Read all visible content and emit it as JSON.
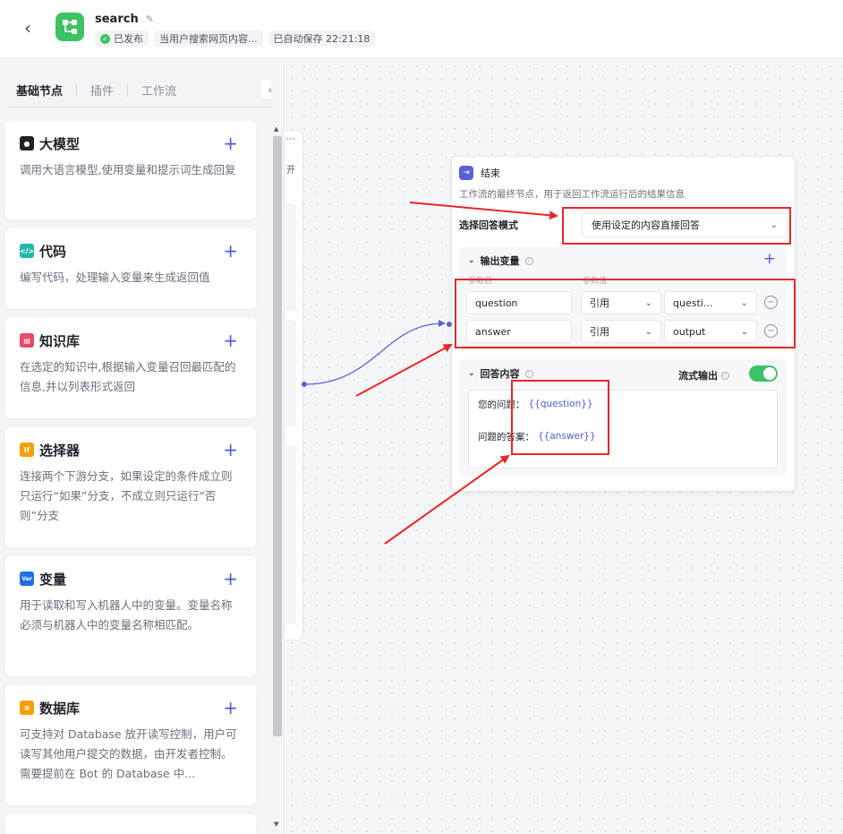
{
  "header": {
    "title": "search",
    "status": "已发布",
    "description": "当用户搜索网页内容...",
    "autosave": "已自动保存 22:21:18"
  },
  "sidebar": {
    "tabs": [
      "基础节点",
      "插件",
      "工作流"
    ],
    "nodes": [
      {
        "name": "大模型",
        "desc": "调用大语言模型,使用变量和提示词生成回复",
        "icon": "llm-icon",
        "color": "#1f2329"
      },
      {
        "name": "代码",
        "desc": "编写代码，处理输入变量来生成返回值",
        "icon": "code-icon",
        "color": "#22b8a7"
      },
      {
        "name": "知识库",
        "desc": "在选定的知识中,根据输入变量召回最匹配的信息,并以列表形式返回",
        "icon": "knowledge-icon",
        "color": "#e84a6a"
      },
      {
        "name": "选择器",
        "desc": "连接两个下游分支，如果设定的条件成立则只运行“如果”分支，不成立则只运行“否则”分支",
        "icon": "if-icon",
        "color": "#f5a000"
      },
      {
        "name": "变量",
        "desc": "用于读取和写入机器人中的变量。变量名称必须与机器人中的变量名称相匹配。",
        "icon": "var-icon",
        "color": "#1f6fe5"
      },
      {
        "name": "数据库",
        "desc": "可支持对 Database 放开读写控制，用户可读写其他用户提交的数据，由开发者控制。需要提前在 Bot 的 Database 中...",
        "icon": "database-icon",
        "color": "#f5a000"
      }
    ]
  },
  "canvas": {
    "hidden_node_text": "开",
    "end_node": {
      "title": "结束",
      "desc": "工作流的最终节点，用于返回工作流运行后的结果信息",
      "mode_label": "选择回答模式",
      "mode_value": "使用设定的内容直接回答",
      "output_section": "输出变量",
      "col_name": "参数名",
      "col_value": "参数值",
      "vars": [
        {
          "name": "question",
          "type": "引用",
          "value": "questi..."
        },
        {
          "name": "answer",
          "type": "引用",
          "value": "output"
        }
      ],
      "answer_section": "回答内容",
      "stream_label": "流式输出",
      "stream_on": true,
      "answer_lines": [
        {
          "label": "您的问题：",
          "ref": "{{question}}"
        },
        {
          "label": "问题的答案：",
          "ref": "{{answer}}"
        }
      ]
    }
  },
  "colors": {
    "accent": "#4e5bd6",
    "success": "#3ec266",
    "annotation": "#e8262a"
  }
}
